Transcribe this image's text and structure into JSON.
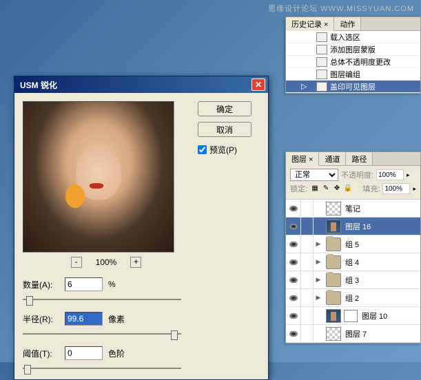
{
  "watermark": "思缘设计论坛 WWW.MISSYUAN.COM",
  "history": {
    "tabs": [
      "历史记录 ×",
      "动作"
    ],
    "items": [
      {
        "label": "载入选区"
      },
      {
        "label": "添加图层蒙版"
      },
      {
        "label": "总体不透明度更改"
      },
      {
        "label": "图层编组"
      },
      {
        "label": "盖印可见图层"
      }
    ]
  },
  "dialog": {
    "title": "USM 锐化",
    "ok": "确定",
    "cancel": "取消",
    "preview": "预览(P)",
    "zoom": "100%",
    "amount": {
      "label": "数量(A):",
      "value": "6",
      "unit": "%"
    },
    "radius": {
      "label": "半径(R):",
      "value": "99.6",
      "unit": "像素"
    },
    "threshold": {
      "label": "阈值(T):",
      "value": "0",
      "unit": "色阶"
    }
  },
  "layers": {
    "tabs": [
      "图层 ×",
      "通道",
      "路径"
    ],
    "blend": "正常",
    "opacity_label": "不透明度:",
    "opacity": "100%",
    "lock_label": "锁定:",
    "fill_label": "填充:",
    "fill": "100%",
    "items": [
      {
        "name": "笔记",
        "thumb": "checker"
      },
      {
        "name": "图层 16",
        "thumb": "photo",
        "selected": true
      },
      {
        "name": "组 5",
        "thumb": "folder",
        "group": true
      },
      {
        "name": "组 4",
        "thumb": "folder",
        "group": true
      },
      {
        "name": "组 3",
        "thumb": "folder",
        "group": true
      },
      {
        "name": "组 2",
        "thumb": "folder",
        "group": true
      },
      {
        "name": "图层 10",
        "thumb": "photo",
        "mask": true
      },
      {
        "name": "图层 7",
        "thumb": "checker"
      }
    ]
  },
  "chart_data": null
}
